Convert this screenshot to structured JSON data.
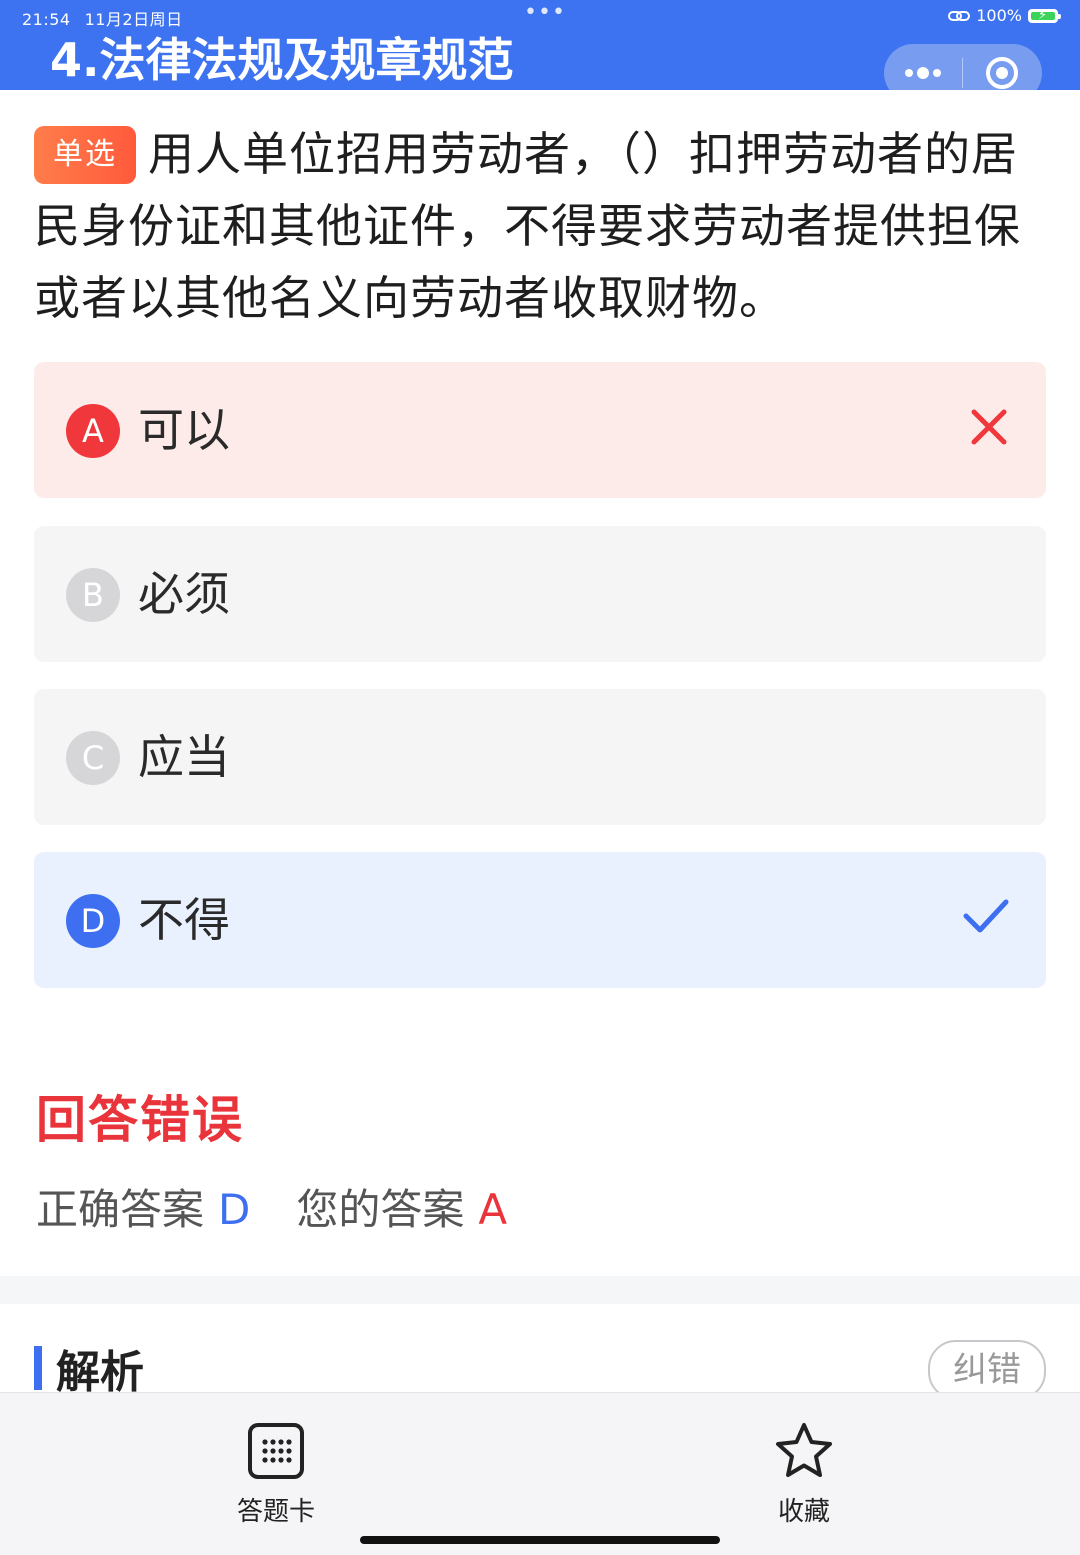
{
  "status_bar": {
    "time": "21:54",
    "date": "11月2日周日",
    "dots": "•••",
    "battery": "100%"
  },
  "header": {
    "title": "4.法律法规及规章规范",
    "menu_icon": "more-dots-icon",
    "target_icon": "target-icon",
    "background_color": "#3D73F0"
  },
  "question": {
    "tag": "单选",
    "text": "用人单位招用劳动者，（）扣押劳动者的居民身份证和其他证件，不得要求劳动者提供担保或者以其他名义向劳动者收取财物。"
  },
  "options": [
    {
      "letter": "A",
      "text": "可以",
      "state": "wrong"
    },
    {
      "letter": "B",
      "text": "必须",
      "state": "normal"
    },
    {
      "letter": "C",
      "text": "应当",
      "state": "normal"
    },
    {
      "letter": "D",
      "text": "不得",
      "state": "correct"
    }
  ],
  "result": {
    "title": "回答错误",
    "correct_label": "正确答案",
    "correct_value": "D",
    "yours_label": "您的答案",
    "yours_value": "A"
  },
  "analysis": {
    "title": "解析",
    "report_button": "纠错"
  },
  "bottom_nav": {
    "answer_card": {
      "label": "答题卡",
      "icon": "grid-icon"
    },
    "favorite": {
      "label": "收藏",
      "icon": "star-icon"
    }
  },
  "colors": {
    "primary": "#3D6FF0",
    "error": "#E8343A",
    "tag_orange": "#FF6A40"
  }
}
